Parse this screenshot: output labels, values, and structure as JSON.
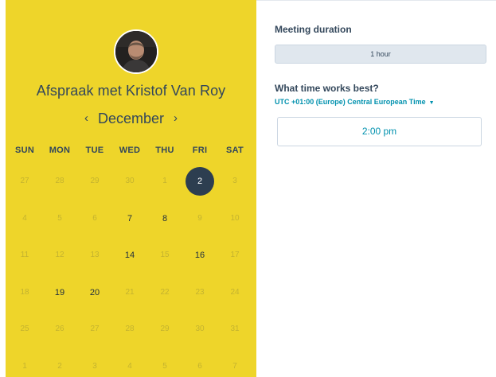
{
  "booking": {
    "title": "Afspraak met Kristof Van Roy",
    "avatar_icon": "user-photo",
    "colors": {
      "panel": "#eed52a",
      "selected": "#2d3e50",
      "link": "#0091ae",
      "text": "#33475b"
    }
  },
  "calendar": {
    "month": "December",
    "prev_icon": "‹",
    "next_icon": "›",
    "weekdays": [
      "SUN",
      "MON",
      "TUE",
      "WED",
      "THU",
      "FRI",
      "SAT"
    ],
    "weeks": [
      [
        {
          "d": "27",
          "s": "muted"
        },
        {
          "d": "28",
          "s": "muted"
        },
        {
          "d": "29",
          "s": "muted"
        },
        {
          "d": "30",
          "s": "muted"
        },
        {
          "d": "1",
          "s": "muted"
        },
        {
          "d": "2",
          "s": "selected"
        },
        {
          "d": "3",
          "s": "muted"
        }
      ],
      [
        {
          "d": "4",
          "s": "muted"
        },
        {
          "d": "5",
          "s": "muted"
        },
        {
          "d": "6",
          "s": "muted"
        },
        {
          "d": "7",
          "s": "available"
        },
        {
          "d": "8",
          "s": "available"
        },
        {
          "d": "9",
          "s": "muted"
        },
        {
          "d": "10",
          "s": "muted"
        }
      ],
      [
        {
          "d": "11",
          "s": "muted"
        },
        {
          "d": "12",
          "s": "muted"
        },
        {
          "d": "13",
          "s": "muted"
        },
        {
          "d": "14",
          "s": "available"
        },
        {
          "d": "15",
          "s": "muted"
        },
        {
          "d": "16",
          "s": "available"
        },
        {
          "d": "17",
          "s": "muted"
        }
      ],
      [
        {
          "d": "18",
          "s": "muted"
        },
        {
          "d": "19",
          "s": "available"
        },
        {
          "d": "20",
          "s": "available"
        },
        {
          "d": "21",
          "s": "muted"
        },
        {
          "d": "22",
          "s": "muted"
        },
        {
          "d": "23",
          "s": "muted"
        },
        {
          "d": "24",
          "s": "muted"
        }
      ],
      [
        {
          "d": "25",
          "s": "muted"
        },
        {
          "d": "26",
          "s": "muted"
        },
        {
          "d": "27",
          "s": "muted"
        },
        {
          "d": "28",
          "s": "muted"
        },
        {
          "d": "29",
          "s": "muted"
        },
        {
          "d": "30",
          "s": "muted"
        },
        {
          "d": "31",
          "s": "muted"
        }
      ],
      [
        {
          "d": "1",
          "s": "muted"
        },
        {
          "d": "2",
          "s": "muted"
        },
        {
          "d": "3",
          "s": "muted"
        },
        {
          "d": "4",
          "s": "muted"
        },
        {
          "d": "5",
          "s": "muted"
        },
        {
          "d": "6",
          "s": "muted"
        },
        {
          "d": "7",
          "s": "muted"
        }
      ]
    ]
  },
  "meeting": {
    "duration_label": "Meeting duration",
    "duration_value": "1 hour",
    "time_question": "What time works best?",
    "timezone": "UTC +01:00 (Europe) Central European Time",
    "timezone_caret_icon": "caret-down",
    "slots": [
      "2:00 pm"
    ]
  }
}
